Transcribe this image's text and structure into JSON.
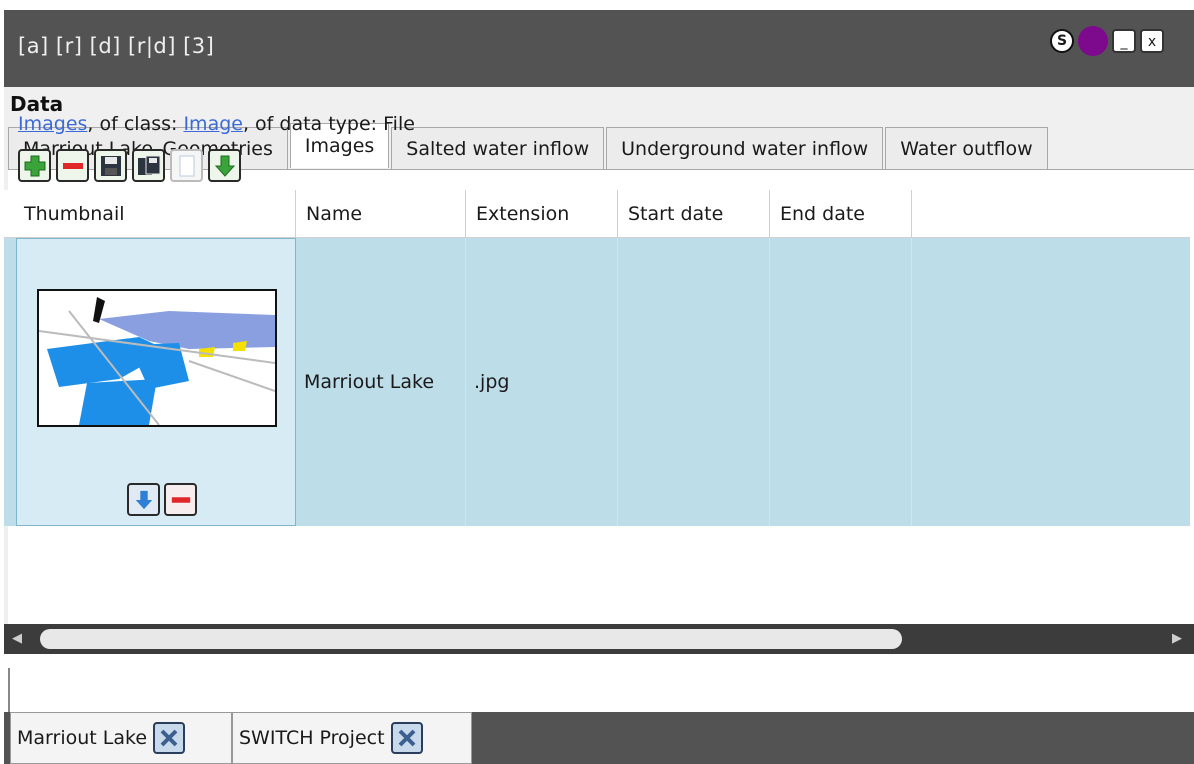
{
  "app": {
    "title": "[a] [r] [d] [r|d] [3]",
    "colors": {
      "titlebar": "#535353",
      "accent_dot": "#7d0a8c",
      "link": "#3b6ad8",
      "selected_row": "#bddde8"
    },
    "window_controls": {
      "s_label": "S",
      "minimize_label": "_",
      "close_label": "x"
    }
  },
  "panel": {
    "title": "Data",
    "tabs": [
      {
        "label": "Marriout Lake_Geometries",
        "active": false
      },
      {
        "label": "Images",
        "active": true
      },
      {
        "label": "Salted water inflow",
        "active": false
      },
      {
        "label": "Underground water inflow",
        "active": false
      },
      {
        "label": "Water outflow",
        "active": false
      }
    ],
    "breadcrumb": {
      "link1": "Images",
      "text1": ", of class: ",
      "link2": "Image",
      "text2": ", of data type: File"
    },
    "toolbar": [
      "add-icon",
      "remove-icon",
      "save-icon",
      "save-all-icon",
      "clear-icon",
      "download-icon"
    ]
  },
  "grid": {
    "headers": [
      "Thumbnail",
      "Name",
      "Extension",
      "Start date",
      "End date"
    ],
    "rows": [
      {
        "name": "Marriout Lake",
        "extension": ".jpg",
        "start_date": "",
        "end_date": ""
      }
    ]
  },
  "doc_tabs": [
    {
      "label": "Marriout Lake"
    },
    {
      "label": "SWITCH Project"
    }
  ]
}
